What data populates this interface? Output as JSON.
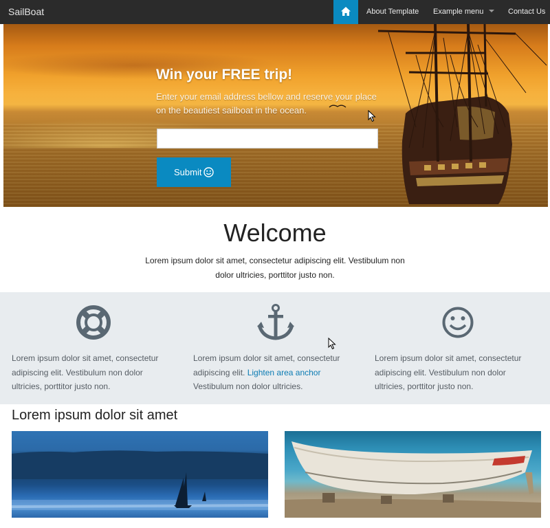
{
  "navbar": {
    "brand": "SailBoat",
    "items": [
      {
        "label": "About Template"
      },
      {
        "label": "Example menu"
      },
      {
        "label": "Contact Us"
      }
    ]
  },
  "hero": {
    "title": "Win your FREE trip!",
    "text": "Enter your email address bellow and reserve your place on the beautiest sailboat in the ocean.",
    "email_value": "",
    "submit_label": "Submit"
  },
  "welcome": {
    "title": "Welcome",
    "text": "Lorem ipsum dolor sit amet, consectetur adipiscing elit. Vestibulum non dolor ultricies, porttitor justo non."
  },
  "features": [
    {
      "icon": "life-ring-icon",
      "text": "Lorem ipsum dolor sit amet, consectetur adipiscing elit. Vestibulum non dolor ultricies, porttitor justo non."
    },
    {
      "icon": "anchor-icon",
      "text_before": "Lorem ipsum dolor sit amet, consectetur adipiscing elit.",
      "link": "Lighten area anchor",
      "text_after": "Vestibulum non dolor ultricies."
    },
    {
      "icon": "smile-icon",
      "text": "Lorem ipsum dolor sit amet, consectetur adipiscing elit. Vestibulum non dolor ultricies, porttitor justo non."
    }
  ],
  "section": {
    "title": "Lorem ipsum dolor sit amet"
  },
  "colors": {
    "accent": "#0a8ac1",
    "navbar": "#2b2b2b",
    "features_bg": "#e8ecef",
    "icon": "#5a6873"
  }
}
